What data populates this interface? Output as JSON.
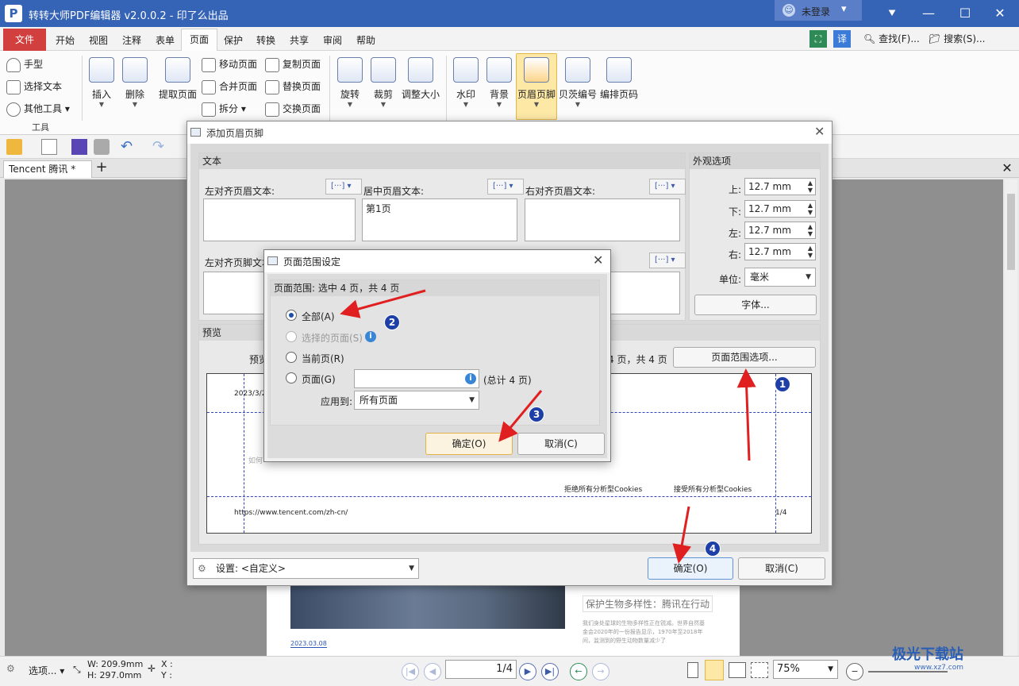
{
  "app": {
    "title": "转转大师PDF编辑器 v2.0.0.2 - 印了么出品",
    "login_label": "未登录"
  },
  "menubar": {
    "file": "文件",
    "items": [
      "开始",
      "视图",
      "注释",
      "表单",
      "页面",
      "保护",
      "转换",
      "共享",
      "审阅",
      "帮助"
    ],
    "active": "页面",
    "find": "查找(F)...",
    "search": "搜索(S)..."
  },
  "ribbon": {
    "tools": [
      "手型",
      "选择文本",
      "其他工具"
    ],
    "tools_group": "工具",
    "insert": "插入",
    "delete": "删除",
    "extract": "提取页面",
    "move": "移动页面",
    "merge": "合并页面",
    "split": "拆分",
    "copy": "复制页面",
    "replace": "替换页面",
    "swap": "交换页面",
    "rotate": "旋转",
    "crop": "裁剪",
    "resize": "调整大小",
    "watermark": "水印",
    "background": "背景",
    "header_footer": "页眉页脚",
    "bates": "贝茨编号",
    "numbering": "编排页码"
  },
  "doctab": {
    "name": "Tencent 腾讯 *"
  },
  "main_dialog": {
    "title": "添加页眉页脚",
    "text_section": "文本",
    "left_header": "左对齐页眉文本:",
    "center_header": "居中页眉文本:",
    "right_header": "右对齐页眉文本:",
    "left_footer": "左对齐页脚文本:",
    "center_header_value": "第1页",
    "appearance": "外观选项",
    "margins": [
      {
        "label": "上:",
        "value": "12.7 mm"
      },
      {
        "label": "下:",
        "value": "12.7 mm"
      },
      {
        "label": "左:",
        "value": "12.7 mm"
      },
      {
        "label": "右:",
        "value": "12.7 mm"
      }
    ],
    "unit_label": "单位:",
    "unit_value": "毫米",
    "font_button": "字体...",
    "preview_section": "预览",
    "preview_label": "预览",
    "preview_pages": "4 页，共 4 页",
    "page_range_button": "页面范围选项...",
    "preview_date": "2023/3/2",
    "preview_hint": "如何",
    "preview_reject": "拒绝所有分析型Cookies",
    "preview_accept": "接受所有分析型Cookies",
    "preview_url": "https://www.tencent.com/zh-cn/",
    "preview_pagenum": "1/4",
    "settings_label": "设置:",
    "settings_value": "<自定义>",
    "ok": "确定(O)",
    "cancel": "取消(C)"
  },
  "sub_dialog": {
    "title": "页面范围设定",
    "header": "页面范围: 选中 4 页，共 4 页",
    "all": "全部(A)",
    "selected": "选择的页面(S)",
    "current": "当前页(R)",
    "pages": "页面(G)",
    "total": "(总计 4 页)",
    "apply_to": "应用到:",
    "apply_value": "所有页面",
    "ok": "确定(O)",
    "cancel": "取消(C)"
  },
  "document_page": {
    "heading": "保护生物多样性：腾讯在行动",
    "body": "我们身处星球的生物多样性正在锐减。世界自然基金会2020年的一份报告显示，1970年至2018年间，监测到的野生动物数量减少了",
    "date": "2023.03.08"
  },
  "statusbar": {
    "options": "选项...",
    "width": "W: 209.9mm",
    "height": "H: 297.0mm",
    "x": "X :",
    "y": "Y :",
    "page": "1/4",
    "zoom": "75%"
  },
  "annotations": [
    "1",
    "2",
    "3",
    "4"
  ],
  "watermark": {
    "brand": "极光下载站",
    "url": "www.xz7.com"
  },
  "colors": {
    "titlebar": "#3563b6",
    "file_tab": "#d23f3f",
    "arrow": "#e02020",
    "badge": "#1f3fa8"
  }
}
